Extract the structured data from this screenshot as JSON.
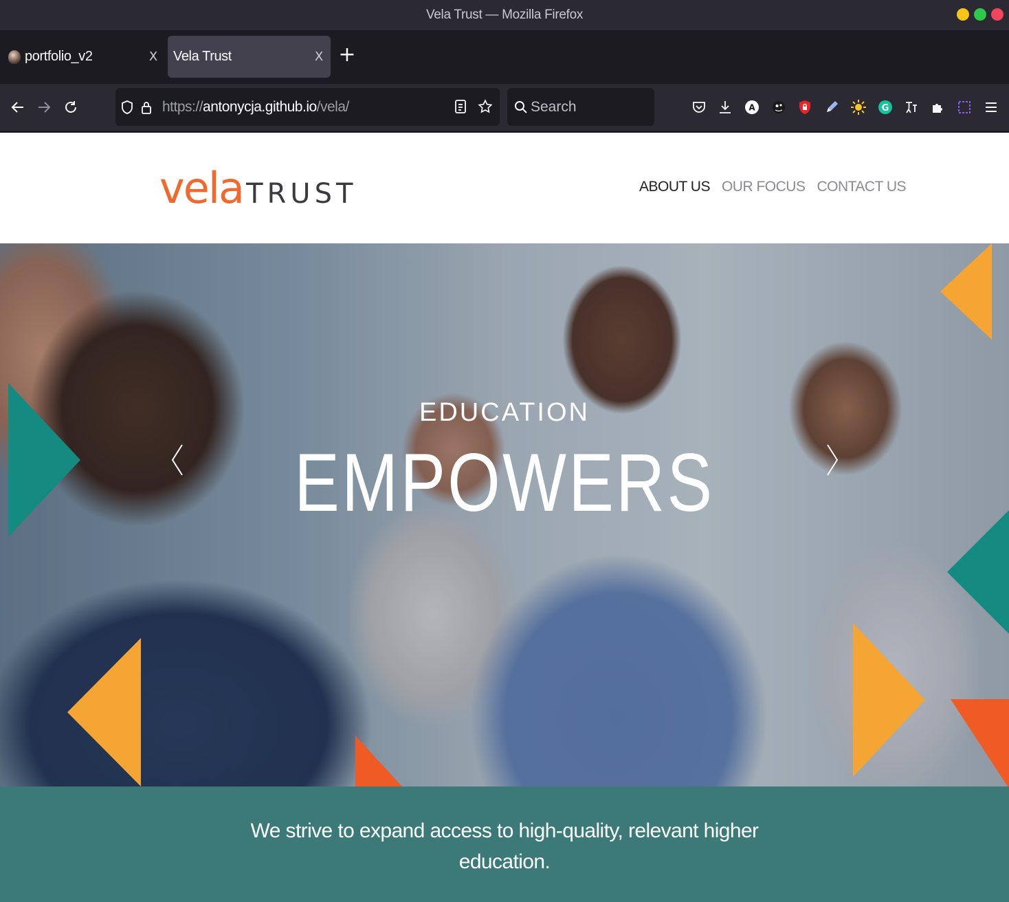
{
  "window": {
    "title": "Vela Trust — Mozilla Firefox"
  },
  "tabs": [
    {
      "label": "portfolio_v2",
      "active": false
    },
    {
      "label": "Vela Trust",
      "active": true
    }
  ],
  "tab_close_glyph": "X",
  "newtab_glyph": "+",
  "urlbar": {
    "scheme": "https://",
    "host": "antonycja.github.io",
    "path": "/vela/"
  },
  "search": {
    "placeholder": "Search"
  },
  "extensions": [
    "pocket-icon",
    "download-icon",
    "extension-a-icon",
    "github-extension-icon",
    "password-lock-icon",
    "pen-icon",
    "dark-reader-icon",
    "grammarly-icon",
    "translate-icon",
    "extensions-puzzle-icon",
    "screenshot-icon",
    "menu-icon"
  ],
  "site": {
    "logo": {
      "primary": "vela",
      "secondary": "TRUST"
    },
    "nav": [
      {
        "label": "ABOUT US",
        "active": true
      },
      {
        "label": "OUR FOCUS",
        "active": false
      },
      {
        "label": "CONTACT US",
        "active": false
      }
    ],
    "hero": {
      "subtitle": "EDUCATION",
      "title": "EMPOWERS"
    },
    "mission": "We strive to expand access to high-quality, relevant higher education."
  },
  "colors": {
    "orange": "#f4a533",
    "orange_red": "#f05a24",
    "teal": "#148a80",
    "mission_band": "#3b7a79",
    "logo_orange": "#ee6a2f"
  }
}
